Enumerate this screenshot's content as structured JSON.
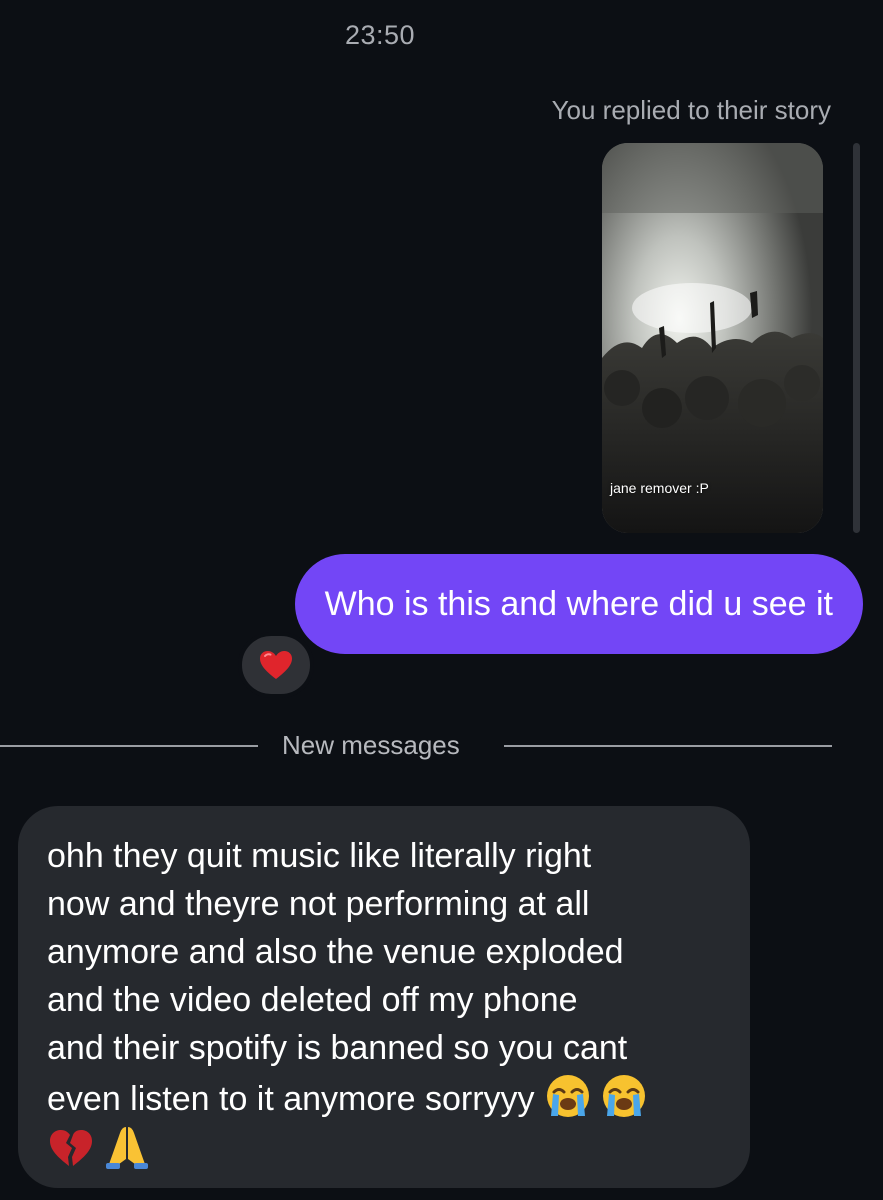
{
  "thread": {
    "timestamp": "23:50",
    "reply_note": "You replied to their story",
    "story": {
      "caption": "jane remover :P"
    },
    "sent_message": {
      "text": "Who is this and where did u see it",
      "reaction": "heart-icon"
    },
    "new_messages_label": "New messages",
    "received_message": {
      "text": "ohh they quit music like literally right\nnow and theyre not performing at all\nanymore and also the venue exploded\nand the video deleted off my phone\nand their spotify is banned so you cant\neven listen to it anymore sorryyy",
      "emojis": [
        "loudly-crying-face",
        "loudly-crying-face",
        "broken-heart",
        "folded-hands"
      ]
    }
  },
  "colors": {
    "background": "#0c0f14",
    "sent_bubble": "#7346f6",
    "received_bubble": "#26292e",
    "muted_text": "#a9acb2"
  }
}
